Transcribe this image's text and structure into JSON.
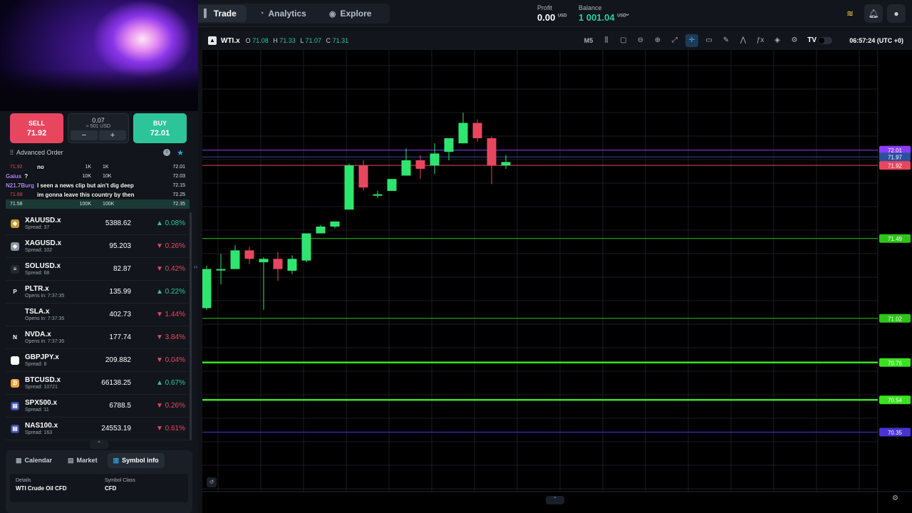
{
  "nav": {
    "tabs": [
      {
        "label": "Trade",
        "icon": "trade-icon"
      },
      {
        "label": "Analytics",
        "icon": "analytics-icon"
      },
      {
        "label": "Explore",
        "icon": "explore-icon"
      }
    ]
  },
  "account": {
    "profit_label": "Profit",
    "profit_value": "0.00",
    "profit_unit": "USD",
    "balance_label": "Balance",
    "balance_value": "1 001.04",
    "balance_unit": "USD"
  },
  "trade": {
    "sell_label": "SELL",
    "sell_price": "71.92",
    "buy_label": "BUY",
    "buy_price": "72.01",
    "volume": "0.07",
    "volume_usd": "≈ 501 USD",
    "minus": "−",
    "plus": "+",
    "advanced_order": "Advanced Order"
  },
  "depth": [
    {
      "bid": "71.92",
      "bvol": "1K",
      "avol": "1K",
      "ask": "72.01"
    },
    {
      "bid": "",
      "bvol": "10K",
      "avol": "10K",
      "ask": "72.03"
    },
    {
      "bid": "",
      "bvol": "",
      "avol": "",
      "ask": "72.15"
    },
    {
      "bid": "71.68",
      "bvol": "",
      "avol": "",
      "ask": "72.25"
    },
    {
      "bid": "71.58",
      "bvol": "100K",
      "avol": "100K",
      "ask": "72.35"
    }
  ],
  "chat": [
    {
      "user": "",
      "msg": "no"
    },
    {
      "user": "Gaius",
      "msg": "?"
    },
    {
      "user": "N21.7Burg",
      "msg": "I seen a news clip but ain't dig deep"
    },
    {
      "user": "",
      "msg": "im gonna leave this country by then"
    }
  ],
  "symbols": [
    {
      "name": "XAUUSD.x",
      "sub": "Spread: 37",
      "price": "5388.62",
      "change": "0.08%",
      "dir": "up",
      "icon": "gold-icon",
      "glyph": "◆",
      "color": "#c99a2e"
    },
    {
      "name": "XAGUSD.x",
      "sub": "Spread: 102",
      "price": "95.203",
      "change": "0.26%",
      "dir": "dn",
      "icon": "silver-icon",
      "glyph": "◆",
      "color": "#8c96a3"
    },
    {
      "name": "SOLUSD.x",
      "sub": "Spread: 68",
      "price": "82.87",
      "change": "0.42%",
      "dir": "dn",
      "icon": "solana-icon",
      "glyph": "≡",
      "color": "#222833"
    },
    {
      "name": "PLTR.x",
      "sub": "Opens in: 7:37:35",
      "price": "135.99",
      "change": "0.22%",
      "dir": "up",
      "icon": "palantir-icon",
      "glyph": "P",
      "color": "#12161c"
    },
    {
      "name": "TSLA.x",
      "sub": "Opens in: 7:37:35",
      "price": "402.73",
      "change": "1.44%",
      "dir": "dn",
      "icon": "tesla-icon",
      "glyph": "",
      "color": "#12161c"
    },
    {
      "name": "NVDA.x",
      "sub": "Opens in: 7:37:35",
      "price": "177.74",
      "change": "3.84%",
      "dir": "dn",
      "icon": "nvidia-icon",
      "glyph": "N",
      "color": "#12161c"
    },
    {
      "name": "GBPJPY.x",
      "sub": "Spread: 8",
      "price": "209.882",
      "change": "0.04%",
      "dir": "dn",
      "icon": "gbp-flag-icon",
      "glyph": "●",
      "color": "#ffffff"
    },
    {
      "name": "BTCUSD.x",
      "sub": "Spread: 10721",
      "price": "66138.25",
      "change": "0.67%",
      "dir": "up",
      "icon": "bitcoin-icon",
      "glyph": "₿",
      "color": "#f2a12e"
    },
    {
      "name": "SPX500.x",
      "sub": "Spread: 11",
      "price": "6788.5",
      "change": "0.26%",
      "dir": "dn",
      "icon": "us-flag-icon",
      "glyph": "▤",
      "color": "#3a4ea8"
    },
    {
      "name": "NAS100.x",
      "sub": "Spread: 163",
      "price": "24553.19",
      "change": "0.61%",
      "dir": "dn",
      "icon": "us-flag-icon",
      "glyph": "▤",
      "color": "#3a4ea8"
    }
  ],
  "bottom_tabs": [
    {
      "label": "Calendar",
      "icon": "calendar-icon"
    },
    {
      "label": "Market",
      "icon": "market-icon"
    },
    {
      "label": "Symbol info",
      "icon": "info-icon"
    }
  ],
  "details": {
    "k1": "Details",
    "v1": "WTI Crude Oil CFD",
    "k2": "Symbol Class",
    "v2": "CFD"
  },
  "chart": {
    "symbol": "WTI.x",
    "o_label": "O",
    "o": "71.08",
    "h_label": "H",
    "h": "71.33",
    "l_label": "L",
    "l": "71.07",
    "c_label": "C",
    "c": "71.31",
    "timeframe": "M5",
    "clock": "06:57:24 (UTC +0)"
  },
  "chart_data": {
    "type": "candlestick",
    "y_range": [
      70.0,
      72.6
    ],
    "candles": [
      {
        "o": 71.08,
        "h": 71.33,
        "l": 71.07,
        "c": 71.31
      },
      {
        "o": 71.31,
        "h": 71.4,
        "l": 71.22,
        "c": 71.31
      },
      {
        "o": 71.31,
        "h": 71.45,
        "l": 71.34,
        "c": 71.42
      },
      {
        "o": 71.42,
        "h": 71.44,
        "l": 71.34,
        "c": 71.37
      },
      {
        "o": 71.35,
        "h": 71.38,
        "l": 71.07,
        "c": 71.37
      },
      {
        "o": 71.37,
        "h": 71.41,
        "l": 71.24,
        "c": 71.31
      },
      {
        "o": 71.3,
        "h": 71.39,
        "l": 71.28,
        "c": 71.37
      },
      {
        "o": 71.36,
        "h": 71.52,
        "l": 71.35,
        "c": 71.52
      },
      {
        "o": 71.52,
        "h": 71.57,
        "l": 71.52,
        "c": 71.56
      },
      {
        "o": 71.56,
        "h": 71.59,
        "l": 71.55,
        "c": 71.59
      },
      {
        "o": 71.66,
        "h": 71.93,
        "l": 71.66,
        "c": 71.92
      },
      {
        "o": 71.92,
        "h": 71.95,
        "l": 71.77,
        "c": 71.79
      },
      {
        "o": 71.75,
        "h": 71.77,
        "l": 71.73,
        "c": 71.75
      },
      {
        "o": 71.77,
        "h": 71.84,
        "l": 71.77,
        "c": 71.84
      },
      {
        "o": 71.86,
        "h": 72.02,
        "l": 71.86,
        "c": 71.95
      },
      {
        "o": 71.95,
        "h": 71.98,
        "l": 71.84,
        "c": 71.9
      },
      {
        "o": 71.92,
        "h": 72.05,
        "l": 71.87,
        "c": 71.99
      },
      {
        "o": 72.0,
        "h": 72.08,
        "l": 71.95,
        "c": 72.08
      },
      {
        "o": 72.05,
        "h": 72.23,
        "l": 72.05,
        "c": 72.17
      },
      {
        "o": 72.17,
        "h": 72.19,
        "l": 72.06,
        "c": 72.08
      },
      {
        "o": 72.08,
        "h": 72.09,
        "l": 71.81,
        "c": 71.92
      },
      {
        "o": 71.92,
        "h": 71.98,
        "l": 71.9,
        "c": 71.94
      }
    ],
    "price_levels": [
      {
        "value": 72.01,
        "label": "72.01",
        "color": "#8b3dff",
        "kind": "ask"
      },
      {
        "value": 71.97,
        "label": "71.97",
        "color": "#2c4f9e",
        "kind": "current"
      },
      {
        "value": 71.92,
        "label": "71.92",
        "color": "#e8465f",
        "kind": "bid"
      },
      {
        "value": 71.49,
        "label": "71.49",
        "color": "#2ec41a",
        "kind": "line"
      },
      {
        "value": 71.02,
        "label": "71.02",
        "color": "#2ec41a",
        "kind": "line"
      },
      {
        "value": 70.76,
        "label": "70.76",
        "color": "#39e31f",
        "kind": "line"
      },
      {
        "value": 70.54,
        "label": "70.54",
        "color": "#39e31f",
        "kind": "line"
      },
      {
        "value": 70.35,
        "label": "70.35",
        "color": "#4b32d6",
        "kind": "line"
      }
    ]
  }
}
